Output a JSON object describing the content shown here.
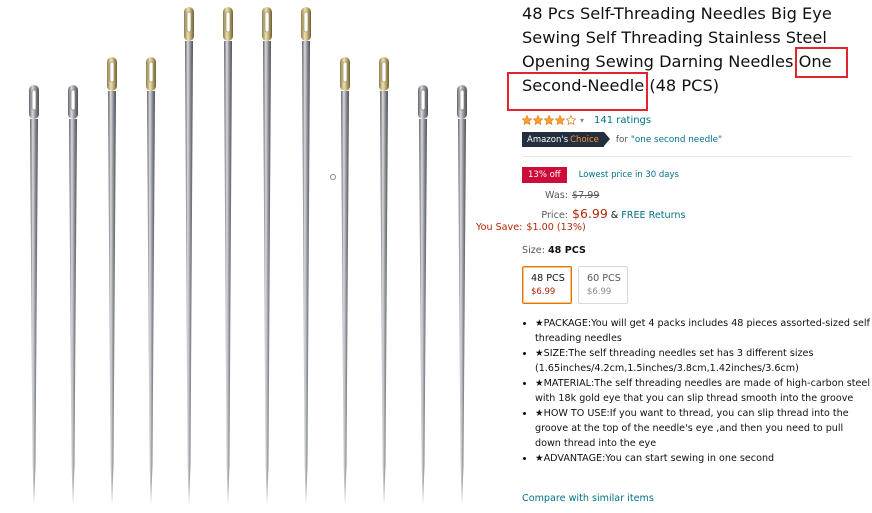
{
  "product": {
    "title": "48 Pcs Self-Threading Needles Big Eye Sewing Self Threading Stainless Steel Opening Sewing Darning Needles One Second-Needle (48 PCS)",
    "rating_stars": 4,
    "ratings_count_label": "141 ratings",
    "badge": {
      "part1": "Amazon's",
      "part2": "Choice"
    },
    "choice_for": "for",
    "choice_term": "\"one second needle\""
  },
  "deal": {
    "badge": "13% off",
    "note": "Lowest price in 30 days"
  },
  "pricing": {
    "was_label": "Was:",
    "was_value": "$7.99",
    "price_label": "Price:",
    "price_value": "$6.99",
    "amp": "&",
    "free_returns": "FREE Returns",
    "save_label": "You Save:",
    "save_value": "$1.00 (13%)"
  },
  "size": {
    "label": "Size:",
    "selected": "48 PCS",
    "options": [
      {
        "name": "48 PCS",
        "price": "$6.99"
      },
      {
        "name": "60 PCS",
        "price": "$6.99"
      }
    ]
  },
  "bullets": [
    "★PACKAGE:You will get 4 packs includes 48 pieces assorted-sized self threading needles",
    "★SIZE:The self threading needles set has 3 different sizes (1.65inches/4.2cm,1.5inches/3.8cm,1.42inches/3.6cm)",
    "★MATERIAL:The self threading needles are made of high-carbon steel with 18k gold eye that you can slip thread smooth into the groove",
    "★HOW TO USE:If you want to thread, you can slip thread into the groove at the top of the needle's eye ,and then you need to pull down thread into the eye",
    "★ADVANTAGE:You can start sewing in one second"
  ],
  "compare_link": "Compare with similar items",
  "colors": {
    "highlight": "#e0252b",
    "price": "#b12704",
    "link": "#007185",
    "deal": "#cc0c39",
    "star": "#ffa41c"
  }
}
